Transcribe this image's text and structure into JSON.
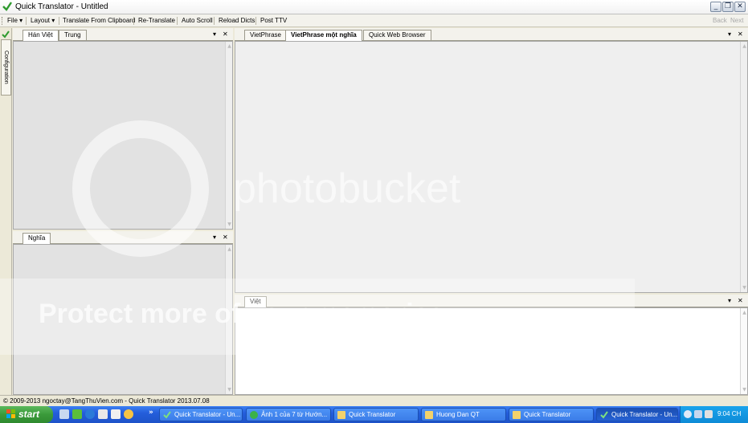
{
  "window": {
    "title": "Quick Translator - Untitled",
    "min": "_",
    "restore": "❐",
    "close": "✕"
  },
  "menu": {
    "file": "File ▾",
    "layout": "Layout ▾",
    "translate_clipboard": "Translate From Clipboard",
    "retranslate": "Re-Translate",
    "auto_scroll": "Auto Scroll",
    "reload_dicts": "Reload Dicts",
    "post_ttv": "Post TTV",
    "back": "Back",
    "next": "Next"
  },
  "sidebar": {
    "configuration": "Configuration"
  },
  "left_top": {
    "tabs": [
      "Hán Việt",
      "Trung"
    ],
    "dropdown": "▾",
    "close": "✕"
  },
  "left_bottom": {
    "tabs": [
      "Nghĩa"
    ],
    "dropdown": "▾",
    "close": "✕"
  },
  "right_top": {
    "tabs": [
      "VietPhrase",
      "VietPhrase một nghĩa",
      "Quick Web Browser"
    ],
    "dropdown": "▾",
    "close": "✕"
  },
  "right_bottom": {
    "tabs": [
      "Việt"
    ],
    "dropdown": "▾",
    "close": "✕"
  },
  "status": {
    "text": "© 2009-2013 ngoctay@TangThuVien.com - Quick Translator 2013.07.08"
  },
  "taskbar": {
    "start": "start",
    "overflow": "»",
    "items": [
      "Quick Translator - Un...",
      "Ảnh 1 của 7 từ Hướn...",
      "Quick Translator",
      "Huong Dan QT",
      "Quick Translator",
      "Quick Translator - Un..."
    ],
    "clock": "9:04 CH"
  },
  "watermark": {
    "brand": "photobucket",
    "protect": "Protect more of your memories"
  },
  "colors": {
    "accent": "#245edb",
    "start": "#3a9a3a",
    "panel_bg": "#e2e2e2"
  }
}
